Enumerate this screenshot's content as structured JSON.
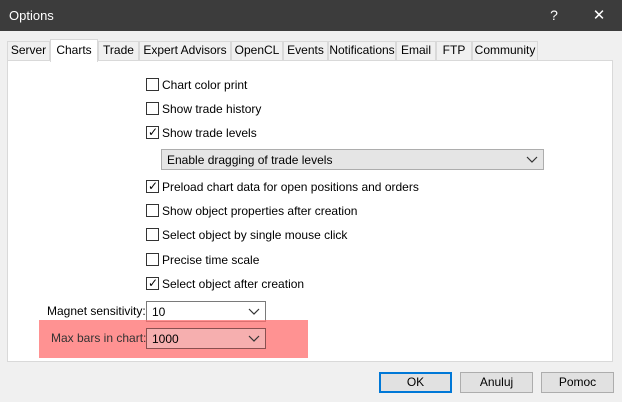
{
  "window": {
    "title": "Options",
    "help_label": "?",
    "close_label": "✕"
  },
  "tabs": [
    {
      "label": "Server"
    },
    {
      "label": "Charts"
    },
    {
      "label": "Trade"
    },
    {
      "label": "Expert Advisors"
    },
    {
      "label": "OpenCL"
    },
    {
      "label": "Events"
    },
    {
      "label": "Notifications"
    },
    {
      "label": "Email"
    },
    {
      "label": "FTP"
    },
    {
      "label": "Community"
    }
  ],
  "active_tab": "Charts",
  "options": [
    {
      "label": "Chart color print",
      "checked": false
    },
    {
      "label": "Show trade history",
      "checked": false
    },
    {
      "label": "Show trade levels",
      "checked": true
    },
    {
      "label": "Preload chart data for open positions and orders",
      "checked": true
    },
    {
      "label": "Show object properties after creation",
      "checked": false
    },
    {
      "label": "Select object by single mouse click",
      "checked": false
    },
    {
      "label": "Precise time scale",
      "checked": false
    },
    {
      "label": "Select object after creation",
      "checked": true
    }
  ],
  "trade_levels_dropdown": {
    "value": "Enable dragging of trade levels"
  },
  "magnet_sensitivity": {
    "label": "Magnet sensitivity:",
    "value": "10"
  },
  "max_bars": {
    "label": "Max bars in chart:",
    "value": "1000"
  },
  "check_glyph": "✓",
  "buttons": {
    "ok": "OK",
    "cancel": "Anuluj",
    "help": "Pomoc"
  },
  "colors": {
    "titlebar": "#3c3c3c",
    "highlight": "#ff6e6e",
    "primary_border": "#0078d7"
  }
}
